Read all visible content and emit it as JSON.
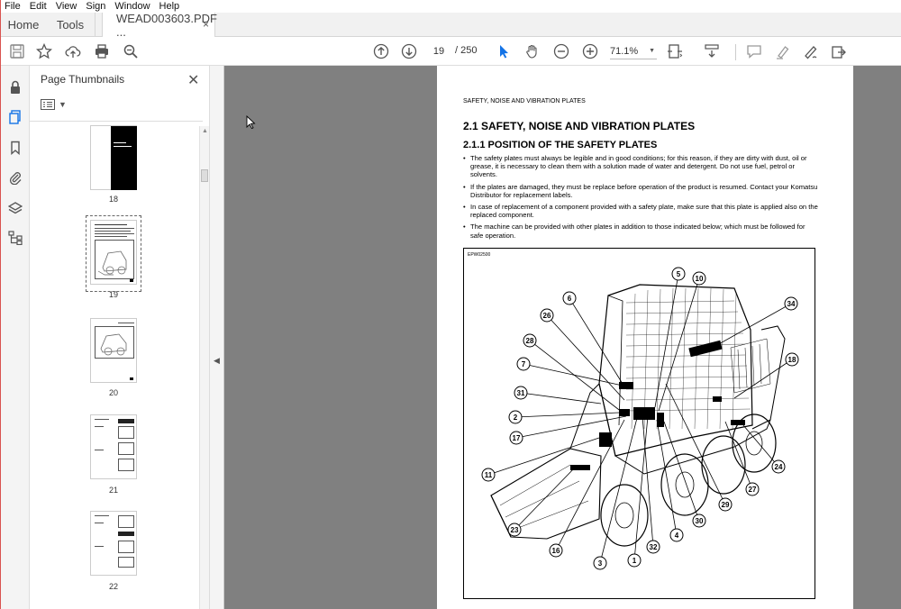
{
  "menu": [
    "File",
    "Edit",
    "View",
    "Sign",
    "Window",
    "Help"
  ],
  "tabs": {
    "home": "Home",
    "tools": "Tools",
    "document": "WEAD003603.PDF ...",
    "close": "×"
  },
  "toolbar": {
    "icons": [
      "save-icon",
      "bookmark-star-icon",
      "upload-cloud-icon",
      "print-icon",
      "zoom-search-icon",
      "page-up-icon",
      "page-down-icon",
      "select-cursor-icon",
      "hand-icon",
      "zoom-out-icon",
      "zoom-in-icon",
      "fit-page-icon",
      "scroll-mode-icon",
      "comment-icon",
      "highlight-icon",
      "sign-icon",
      "share-icon"
    ],
    "current_page": "19",
    "total_pages": "/ 250",
    "zoom": "71.1%"
  },
  "thumbnails_panel": {
    "title": "Page Thumbnails",
    "close": "✕",
    "pages": [
      {
        "label": "18"
      },
      {
        "label": "19",
        "selected": true
      },
      {
        "label": "20"
      },
      {
        "label": "21"
      },
      {
        "label": "22"
      }
    ]
  },
  "page": {
    "running_head": "SAFETY, NOISE AND VIBRATION PLATES",
    "heading1": "2.1   SAFETY, NOISE AND VIBRATION PLATES",
    "heading2": "2.1.1   POSITION OF THE SAFETY PLATES",
    "bullets": [
      "The safety plates must always be legible and in good conditions; for this reason, if they are dirty with dust, oil or grease, it is necessary to clean them with a solution made of water and detergent. Do not use fuel, petrol or solvents.",
      "If the plates are damaged, they must be replace before operation of the product is resumed. Contact your Komatsu Distributor for replacement labels.",
      "In case of replacement of a component provided with a safety plate, make sure that this plate is applied also on the replaced component.",
      "The machine can be provided with other plates in addition to those indicated below; which must be followed for safe operation."
    ],
    "figure_code": "EPW02500",
    "callouts": [
      "5",
      "10",
      "6",
      "34",
      "26",
      "28",
      "18",
      "7",
      "31",
      "2",
      "17",
      "11",
      "24",
      "27",
      "29",
      "30",
      "4",
      "23",
      "16",
      "3",
      "32",
      "1"
    ]
  }
}
